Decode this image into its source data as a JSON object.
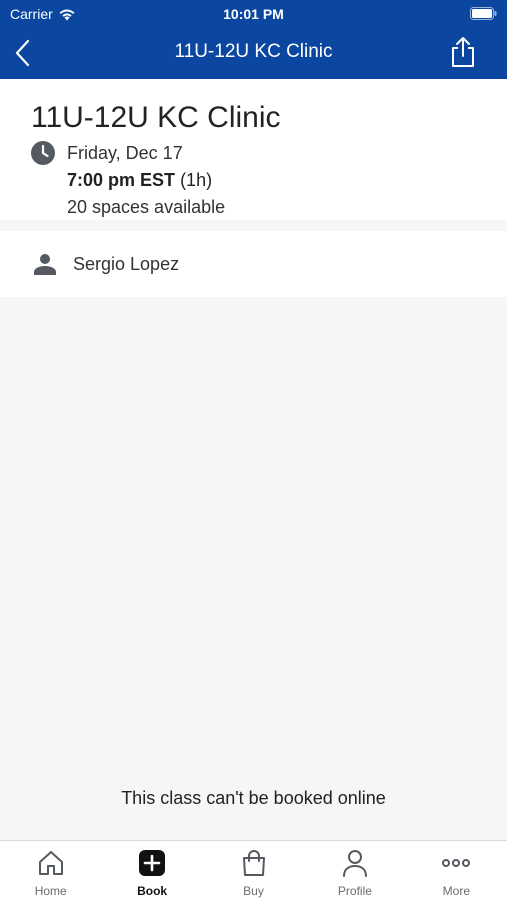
{
  "status_bar": {
    "carrier": "Carrier",
    "time": "10:01 PM"
  },
  "nav": {
    "title": "11U-12U KC Clinic"
  },
  "class_info": {
    "title": "11U-12U KC Clinic",
    "date": "Friday, Dec 17",
    "start_time": "7:00 pm EST",
    "duration": "(1h)",
    "availability": "20 spaces available"
  },
  "instructor": {
    "name": "Sergio Lopez"
  },
  "notice": "This class can't be booked online",
  "tabs": [
    {
      "label": "Home",
      "icon": "home-icon"
    },
    {
      "label": "Book",
      "icon": "plus-square-icon",
      "active": true
    },
    {
      "label": "Buy",
      "icon": "shopping-bag-icon"
    },
    {
      "label": "Profile",
      "icon": "person-icon"
    },
    {
      "label": "More",
      "icon": "ellipsis-icon"
    }
  ],
  "colors": {
    "brand": "#0b47a1",
    "background": "#f5f6f8"
  }
}
